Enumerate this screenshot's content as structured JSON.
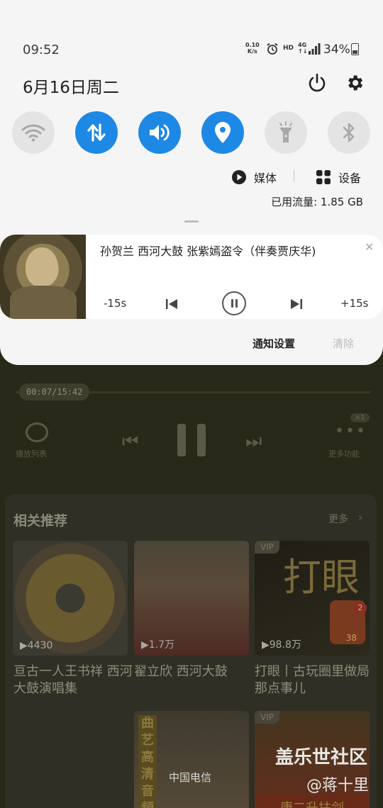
{
  "status_bar": {
    "time": "09:52",
    "net_speed_value": "0.10",
    "net_speed_unit": "K/s",
    "alarm_icon": "alarm-icon",
    "hd_label": "HD",
    "network_label": "4G",
    "signal_icon": "signal-icon",
    "battery_percent": "34%",
    "battery_level": 0.34
  },
  "quick_panel": {
    "date": "6月16日周二",
    "power_icon": "power-icon",
    "settings_icon": "gear-icon",
    "tiles": [
      {
        "name": "wifi",
        "icon": "wifi-icon",
        "active": false
      },
      {
        "name": "mobile-data",
        "icon": "data-arrows-icon",
        "active": true
      },
      {
        "name": "sound",
        "icon": "speaker-icon",
        "active": true
      },
      {
        "name": "location",
        "icon": "location-pin-icon",
        "active": true
      },
      {
        "name": "flashlight",
        "icon": "flashlight-icon",
        "active": false
      },
      {
        "name": "bluetooth",
        "icon": "bluetooth-icon",
        "active": false
      }
    ],
    "media_label": "媒体",
    "device_label": "设备",
    "data_usage": "已用流量: 1.85 GB",
    "active_color": "#1e88e5"
  },
  "media_notification": {
    "title": "孙贺兰 西河大鼓 张紫嫣盗令（伴奏贾庆华)",
    "rewind_label": "-15s",
    "forward_label": "+15s",
    "close_icon": "close-icon"
  },
  "notification_actions": {
    "settings_label": "通知设置",
    "clear_label": "清除"
  },
  "background_app": {
    "progress_time": "00:07/15:42",
    "playlist_label": "播放列表",
    "more_label": "更多功能",
    "speed_badge": "×1",
    "recommend_title": "相关推荐",
    "recommend_more": "更多",
    "items": [
      {
        "plays": "▶4430",
        "title": "亘古一人王书祥 西河大鼓演唱集",
        "vip": ""
      },
      {
        "plays": "▶1.7万",
        "title": "翟立欣 西河大鼓",
        "vip": ""
      },
      {
        "plays": "▶98.8万",
        "title": "打眼丨古玩圈里做局那点事儿",
        "vip": "VIP"
      },
      {
        "plays": "",
        "title": "",
        "vip": ""
      },
      {
        "plays": "",
        "title": "",
        "vip": "VIP"
      }
    ],
    "thumb3_text": "打眼",
    "thumb3_badge_count": "2",
    "thumb3_badge_value": "38",
    "thumb4_vertical_text": "曲艺高清音頻",
    "thumb5_banner_text": "康二升扶剑"
  },
  "overlay": {
    "carrier": "中国电信",
    "watermark_site": "盖乐世社区",
    "watermark_user": "@蒋十里"
  }
}
